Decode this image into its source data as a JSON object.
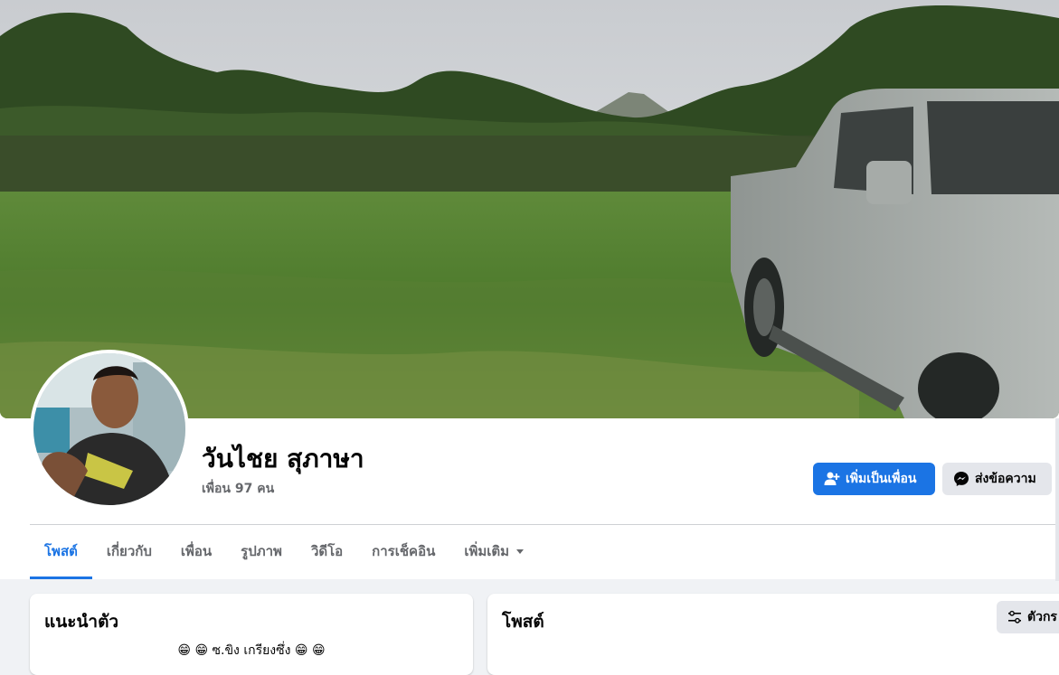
{
  "profile": {
    "name": "วันไชย สุภาษา",
    "friends_count": "เพื่อน 97 คน"
  },
  "actions": {
    "add_friend": "เพิ่มเป็นเพื่อน",
    "message": "ส่งข้อความ"
  },
  "tabs": [
    {
      "label": "โพสต์",
      "active": true
    },
    {
      "label": "เกี่ยวกับ"
    },
    {
      "label": "เพื่อน"
    },
    {
      "label": "รูปภาพ"
    },
    {
      "label": "วิดีโอ"
    },
    {
      "label": "การเช็คอิน"
    },
    {
      "label": "เพิ่มเติม"
    }
  ],
  "intro": {
    "title": "แนะนำตัว",
    "bio": "😁 😁 ซ.ขิง เกรียงซึ่ง 😁 😁"
  },
  "posts": {
    "title": "โพสต์",
    "filter_label": "ตัวกร"
  },
  "colors": {
    "accent": "#1b74e4",
    "secondary_button": "#e4e6eb",
    "muted_text": "#65676b",
    "background": "#f0f2f5"
  },
  "icons": {
    "add_friend": "person-plus-icon",
    "message": "messenger-icon",
    "more": "caret-down-icon",
    "filter": "filter-sliders-icon"
  }
}
